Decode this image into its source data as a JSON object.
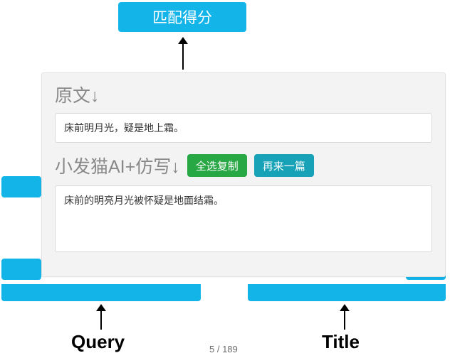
{
  "top_box": {
    "label": "匹配得分"
  },
  "card": {
    "original": {
      "title": "原文↓",
      "text": "床前明月光，疑是地上霜。"
    },
    "rewrite": {
      "title": "小发猫AI+仿写↓",
      "copy_btn": "全选复制",
      "again_btn": "再来一篇",
      "text": "床前的明亮月光被怀疑是地面结霜。"
    }
  },
  "labels": {
    "query": "Query",
    "title": "Title"
  },
  "pager": {
    "text": "5 / 189"
  }
}
